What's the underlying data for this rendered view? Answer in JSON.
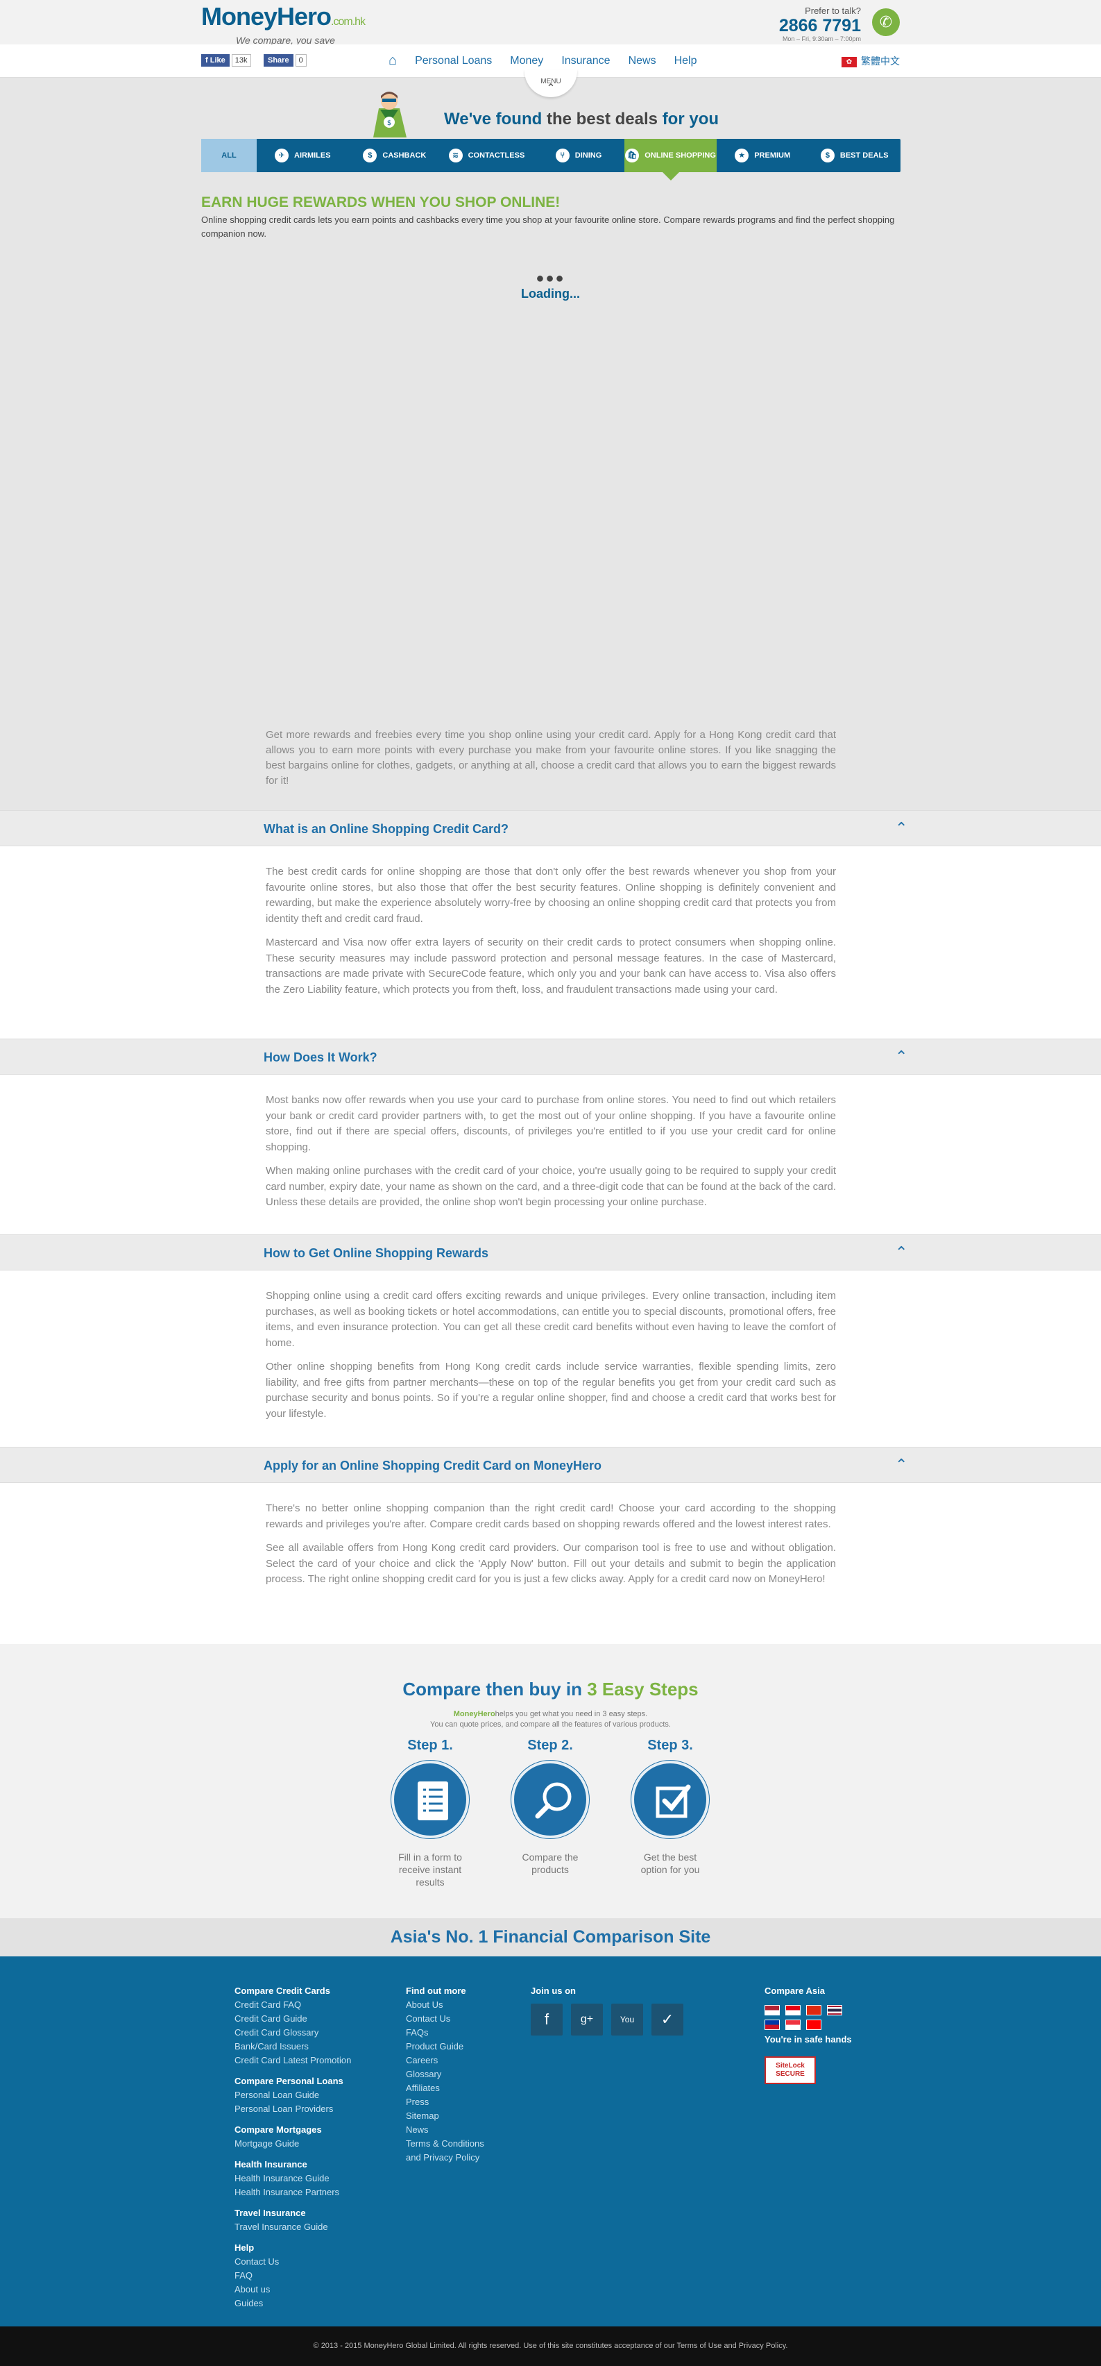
{
  "header": {
    "logo_main": "MoneyHero",
    "logo_suffix": ".com.hk",
    "tagline": "We compare, you save",
    "prefer": "Prefer to talk?",
    "phone": "2866 7791",
    "hours": "Mon – Fri, 9:30am – 7:00pm"
  },
  "social": {
    "like": "Like",
    "like_count": "13k",
    "share": "Share",
    "share_count": "0"
  },
  "nav": {
    "items": [
      "Personal Loans",
      "Money",
      "Insurance",
      "News",
      "Help"
    ],
    "lang": "繁體中文",
    "menu": "MENU"
  },
  "hero": {
    "found_a": "We've found",
    "found_b": "the best deals",
    "found_c": "for you",
    "tabs": [
      {
        "label": "ALL",
        "icon": ""
      },
      {
        "label": "AIRMILES",
        "icon": "✈"
      },
      {
        "label": "CASHBACK",
        "icon": "$"
      },
      {
        "label": "CONTACTLESS",
        "icon": "≋"
      },
      {
        "label": "DINING",
        "icon": "⑂"
      },
      {
        "label": "ONLINE SHOPPING",
        "icon": "🛍"
      },
      {
        "label": "PREMIUM",
        "icon": "★"
      },
      {
        "label": "BEST DEALS",
        "icon": "$"
      }
    ],
    "title": "EARN HUGE REWARDS WHEN YOU SHOP ONLINE!",
    "desc": "Online shopping credit cards lets you earn points and cashbacks every time you shop at your favourite online store. Compare rewards programs and find the perfect shopping companion now.",
    "loading": "Loading..."
  },
  "intro": "Get more rewards and freebies every time you shop online using your credit card. Apply for a Hong Kong credit card that allows you to earn more points with every purchase you make from your favourite online stores. If you like snagging the best bargains online for clothes, gadgets, or anything at all, choose a credit card that allows you to earn the biggest rewards for it!",
  "sections": [
    {
      "title": "What is an Online Shopping Credit Card?",
      "p1": "The best credit cards for online shopping are those that don't only offer the best rewards whenever you shop from your favourite online stores, but also those that offer the best security features. Online shopping is definitely convenient and rewarding, but make the experience absolutely worry-free by choosing an online shopping credit card that protects you from identity theft and credit card fraud.",
      "p2": "Mastercard and Visa now offer extra layers of security on their credit cards to protect consumers when shopping online. These security measures may include password protection and personal message features. In the case of Mastercard, transactions are made private with SecureCode feature, which only you and your bank can have access to. Visa also offers the Zero Liability feature, which protects you from theft, loss, and fraudulent transactions made using your card."
    },
    {
      "title": "How Does It Work?",
      "p1": "Most banks now offer rewards when you use your card to purchase from online stores. You need to find out which retailers your bank or credit card provider partners with, to get the most out of your online shopping. If you have a favourite online store, find out if there are special offers, discounts, of privileges you're entitled to if you use your credit card for online shopping.",
      "p2": "When making online purchases with the credit card of your choice, you're usually going to be required to supply your credit card number, expiry date, your name as shown on the card, and a three-digit code that can be found at the back of the card. Unless these details are provided, the online shop won't begin processing your online purchase."
    },
    {
      "title": "How to Get Online Shopping Rewards",
      "p1": "Shopping online using a credit card offers exciting rewards and unique privileges. Every online transaction, including item purchases, as well as booking tickets or hotel accommodations, can entitle you to special discounts, promotional offers, free items, and even insurance protection. You can get all these credit card benefits without even having to leave the comfort of home.",
      "p2": "Other online shopping benefits from Hong Kong credit cards include service warranties, flexible spending limits, zero liability, and free gifts from partner merchants—these on top of the regular benefits you get from your credit card such as purchase security and bonus points. So if you're a regular online shopper, find and choose a credit card that works best for your lifestyle."
    },
    {
      "title": "Apply for an Online Shopping Credit Card on MoneyHero",
      "p1": "There's no better online shopping companion than the right credit card! Choose your card according to the shopping rewards and privileges you're after. Compare credit cards based on shopping rewards offered and the lowest interest rates.",
      "p2": "See all available offers from Hong Kong credit card providers. Our comparison tool is free to use and without obligation. Select the card of your choice and click the 'Apply Now' button. Fill out your details and submit to begin the application process. The right online shopping credit card for you is just a few clicks away. Apply for a credit card now on MoneyHero!"
    }
  ],
  "steps": {
    "title_a": "Compare then buy in",
    "title_b": "3 Easy Steps",
    "brand": "MoneyHero",
    "sub1": "helps you get what you need in 3 easy steps.",
    "sub2": "You can quote prices, and compare all the features of various products.",
    "items": [
      {
        "label": "Step 1.",
        "desc": "Fill in a form to receive instant results",
        "icon": "form-icon"
      },
      {
        "label": "Step 2.",
        "desc": "Compare the products",
        "icon": "magnifier-icon"
      },
      {
        "label": "Step 3.",
        "desc": "Get the best option for you",
        "icon": "checkbox-icon"
      }
    ]
  },
  "asia": "Asia's No. 1 Financial Comparison Site",
  "footer": {
    "col1": [
      {
        "h": "Compare Credit Cards",
        "links": [
          "Credit Card FAQ",
          "Credit Card Guide",
          "Credit Card Glossary",
          "Bank/Card Issuers",
          "Credit Card Latest Promotion"
        ]
      },
      {
        "h": "Compare Personal Loans",
        "links": [
          "Personal Loan Guide",
          "Personal Loan Providers"
        ]
      },
      {
        "h": "Compare Mortgages",
        "links": [
          "Mortgage Guide"
        ]
      },
      {
        "h": "Health Insurance",
        "links": [
          "Health Insurance Guide",
          "Health Insurance Partners"
        ]
      },
      {
        "h": "Travel Insurance",
        "links": [
          "Travel Insurance Guide"
        ]
      },
      {
        "h": "Help",
        "links": [
          "Contact Us",
          "FAQ",
          "About us",
          "Guides"
        ]
      }
    ],
    "col2": {
      "h": "Find out more",
      "links": [
        "About Us",
        "Contact Us",
        "FAQs",
        "Product Guide",
        "Careers",
        "Glossary",
        "Affiliates",
        "Press",
        "Sitemap",
        "News",
        "Terms & Conditions",
        "and Privacy Policy"
      ]
    },
    "join": "Join us on",
    "social_icons": [
      "facebook-icon",
      "google-plus-icon",
      "youtube-icon",
      "blog-icon"
    ],
    "compare_asia": "Compare Asia",
    "safe": "You're in safe hands",
    "sitelock": "SiteLock SECURE",
    "copyright": "© 2013 - 2015 MoneyHero Global Limited. All rights reserved. Use of this site constitutes acceptance of our Terms of Use and Privacy Policy."
  }
}
